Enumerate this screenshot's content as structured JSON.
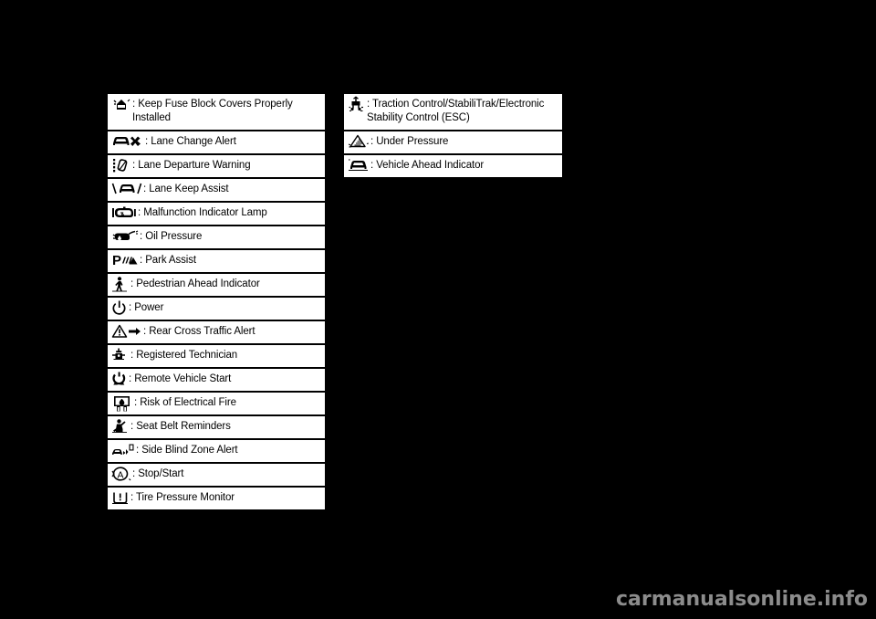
{
  "page": {
    "background_color": "#000000",
    "row_background_color": "#ffffff",
    "row_text_color": "#000000",
    "watermark": "carmanualsonline.info",
    "watermark_color": "#8c8c8c"
  },
  "left_column": {
    "items": [
      {
        "icon": "fuse-block-cover-icon",
        "separator": ":",
        "label": "Keep Fuse Block Covers Properly Installed",
        "tall": true
      },
      {
        "icon": "lane-change-alert-icon",
        "separator": ":",
        "label": "Lane Change Alert",
        "tall": false
      },
      {
        "icon": "lane-departure-warning-icon",
        "separator": ":",
        "label": "Lane Departure Warning",
        "tall": false
      },
      {
        "icon": "lane-keep-assist-icon",
        "separator": ":",
        "label": "Lane Keep Assist",
        "tall": false
      },
      {
        "icon": "malfunction-indicator-lamp-icon",
        "separator": ":",
        "label": "Malfunction Indicator Lamp",
        "tall": false
      },
      {
        "icon": "oil-pressure-icon",
        "separator": ":",
        "label": "Oil Pressure",
        "tall": false
      },
      {
        "icon": "park-assist-icon",
        "separator": ":",
        "label": "Park Assist",
        "tall": false
      },
      {
        "icon": "pedestrian-ahead-indicator-icon",
        "separator": ":",
        "label": "Pedestrian Ahead Indicator",
        "tall": false
      },
      {
        "icon": "power-icon",
        "separator": ":",
        "label": "Power",
        "tall": false
      },
      {
        "icon": "rear-cross-traffic-alert-icon",
        "separator": ":",
        "label": "Rear Cross Traffic Alert",
        "tall": false
      },
      {
        "icon": "registered-technician-icon",
        "separator": ":",
        "label": "Registered Technician",
        "tall": false
      },
      {
        "icon": "remote-vehicle-start-icon",
        "separator": ":",
        "label": "Remote Vehicle Start",
        "tall": false
      },
      {
        "icon": "risk-of-electrical-fire-icon",
        "separator": ":",
        "label": "Risk of Electrical Fire",
        "tall": false
      },
      {
        "icon": "seat-belt-reminders-icon",
        "separator": ":",
        "label": "Seat Belt Reminders",
        "tall": false
      },
      {
        "icon": "side-blind-zone-alert-icon",
        "separator": ":",
        "label": "Side Blind Zone Alert",
        "tall": false
      },
      {
        "icon": "stop-start-icon",
        "separator": ":",
        "label": "Stop/Start",
        "tall": false
      },
      {
        "icon": "tire-pressure-monitor-icon",
        "separator": ":",
        "label": "Tire Pressure Monitor",
        "tall": false
      }
    ]
  },
  "right_column": {
    "items": [
      {
        "icon": "traction-control-icon",
        "separator": ":",
        "label": "Traction Control/StabiliTrak/Electronic Stability Control (ESC)",
        "tall": true
      },
      {
        "icon": "under-pressure-icon",
        "separator": ":",
        "label": "Under Pressure",
        "tall": false
      },
      {
        "icon": "vehicle-ahead-indicator-icon",
        "separator": ":",
        "label": "Vehicle Ahead Indicator",
        "tall": false
      }
    ]
  }
}
